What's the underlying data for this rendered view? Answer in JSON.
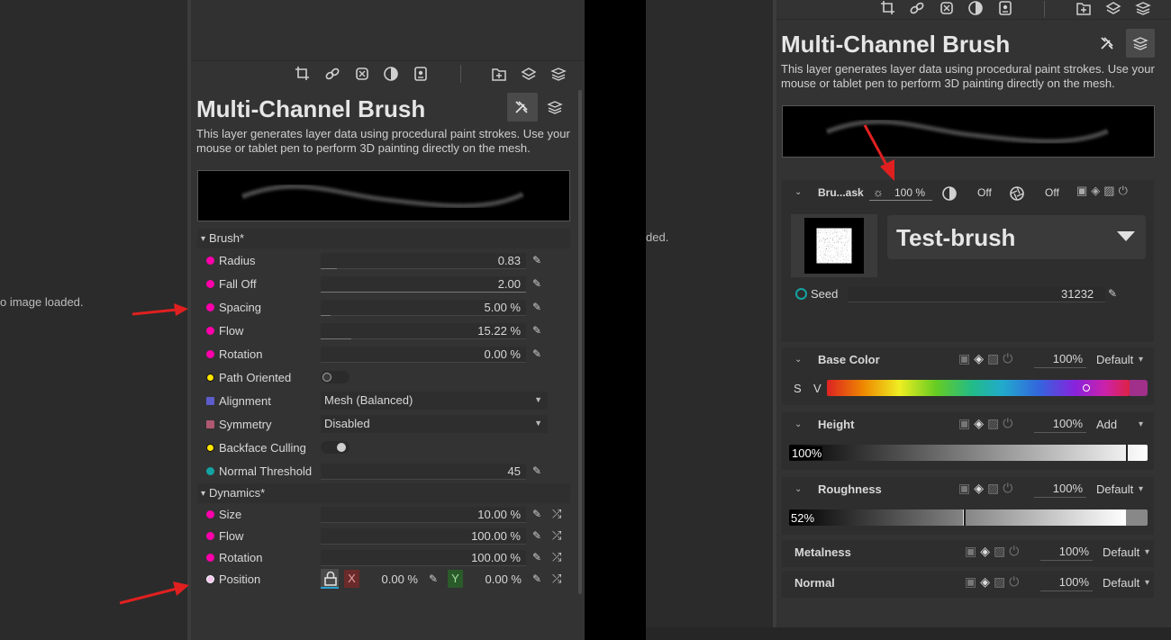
{
  "left_viewer": {
    "message": "o image loaded."
  },
  "middle_viewer": {
    "message": "ded."
  },
  "left_panel": {
    "title": "Multi-Channel Brush",
    "description": "This layer generates layer data using procedural paint strokes. Use your mouse or tablet pen to perform 3D painting directly on the mesh.",
    "brush_section": "Brush*",
    "dynamics_section": "Dynamics*",
    "brush_rows": [
      {
        "label": "Radius",
        "value": "0.83",
        "fill": 0.08
      },
      {
        "label": "Fall Off",
        "value": "2.00",
        "fill": 1.0
      },
      {
        "label": "Spacing",
        "value": "5.00 %",
        "fill": 0.05
      },
      {
        "label": "Flow",
        "value": "15.22 %",
        "fill": 0.15
      },
      {
        "label": "Rotation",
        "value": "0.00 %",
        "fill": 0.0
      }
    ],
    "path_oriented": {
      "label": "Path Oriented"
    },
    "alignment": {
      "label": "Alignment",
      "value": "Mesh (Balanced)"
    },
    "symmetry": {
      "label": "Symmetry",
      "value": "Disabled"
    },
    "backface": {
      "label": "Backface Culling"
    },
    "normal_threshold": {
      "label": "Normal Threshold",
      "value": "45"
    },
    "dynamics_rows": [
      {
        "label": "Size",
        "value": "10.00 %"
      },
      {
        "label": "Flow",
        "value": "100.00 %"
      },
      {
        "label": "Rotation",
        "value": "100.00 %"
      }
    ],
    "position": {
      "label": "Position",
      "x_label": "X",
      "x_value": "0.00 %",
      "y_label": "Y",
      "y_value": "0.00 %"
    }
  },
  "right_panel": {
    "title": "Multi-Channel Brush",
    "description": "This layer generates layer data using procedural paint strokes. Use your mouse or tablet pen to perform 3D painting directly on the mesh.",
    "mask_header": {
      "label": "Bru...ask",
      "intensity": "100 %",
      "off1": "Off",
      "off2": "Off"
    },
    "brush_name": "Test-brush",
    "seed": {
      "label": "Seed",
      "value": "31232"
    },
    "channels": [
      {
        "name": "Base Color",
        "pct": "100%",
        "blend": "Default"
      },
      {
        "name": "Height",
        "pct": "100%",
        "blend": "Add",
        "bar_value": "100%"
      },
      {
        "name": "Roughness",
        "pct": "100%",
        "blend": "Default",
        "bar_value": "52%"
      },
      {
        "name": "Metalness",
        "pct": "100%",
        "blend": "Default"
      },
      {
        "name": "Normal",
        "pct": "100%",
        "blend": "Default"
      }
    ],
    "sv_labels": {
      "s": "S",
      "v": "V"
    }
  },
  "colors": {
    "magenta": "#ff00aa",
    "yellow": "#ffe600",
    "teal": "#14a3a3",
    "arrow_red": "#e02020"
  }
}
